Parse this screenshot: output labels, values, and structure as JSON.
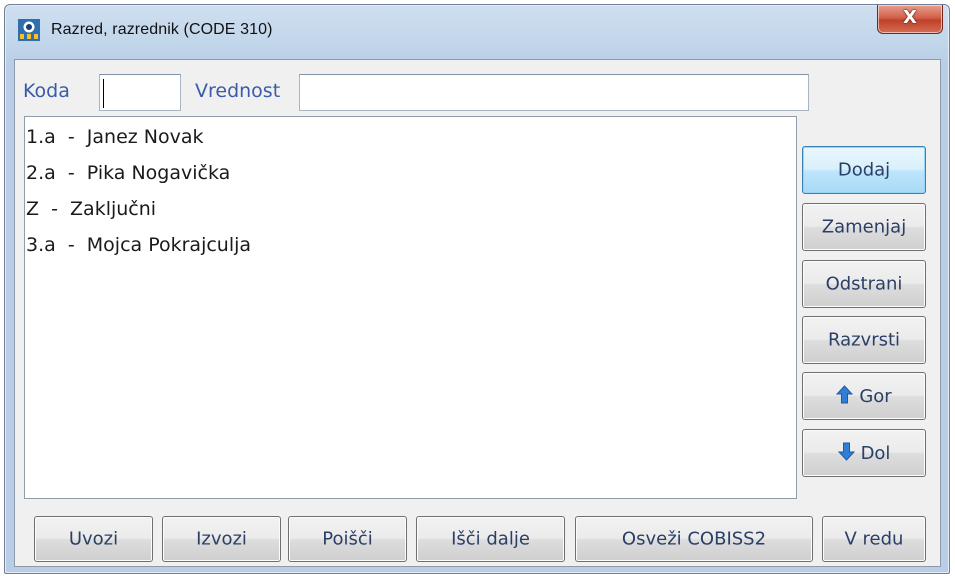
{
  "window": {
    "title": "Razred, razrednik (CODE 310)",
    "close_label": "X",
    "app_icon": "cobiss-app-icon"
  },
  "search": {
    "code_label": "Koda",
    "code_value": "",
    "value_label": "Vrednost",
    "value_value": ""
  },
  "list": {
    "items": [
      {
        "label": "1.a  -  Janez Novak"
      },
      {
        "label": "2.a  -  Pika Nogavička"
      },
      {
        "label": "Z  -  Zaključni"
      },
      {
        "label": "3.a  -  Mojca Pokrajculja"
      }
    ]
  },
  "side_buttons": {
    "add": "Dodaj",
    "replace": "Zamenjaj",
    "remove": "Odstrani",
    "sort": "Razvrsti",
    "up": "Gor",
    "down": "Dol",
    "up_icon": "arrow-up-icon",
    "down_icon": "arrow-down-icon"
  },
  "bottom_buttons": {
    "import": "Uvozi",
    "export": "Izvozi",
    "find": "Poišči",
    "find_next": "Išči dalje",
    "refresh": "Osveži COBISS2",
    "ok": "V redu"
  },
  "colors": {
    "label_blue": "#3b5aa8",
    "arrow_blue": "#2f7fd6",
    "close_red": "#c0412a"
  }
}
